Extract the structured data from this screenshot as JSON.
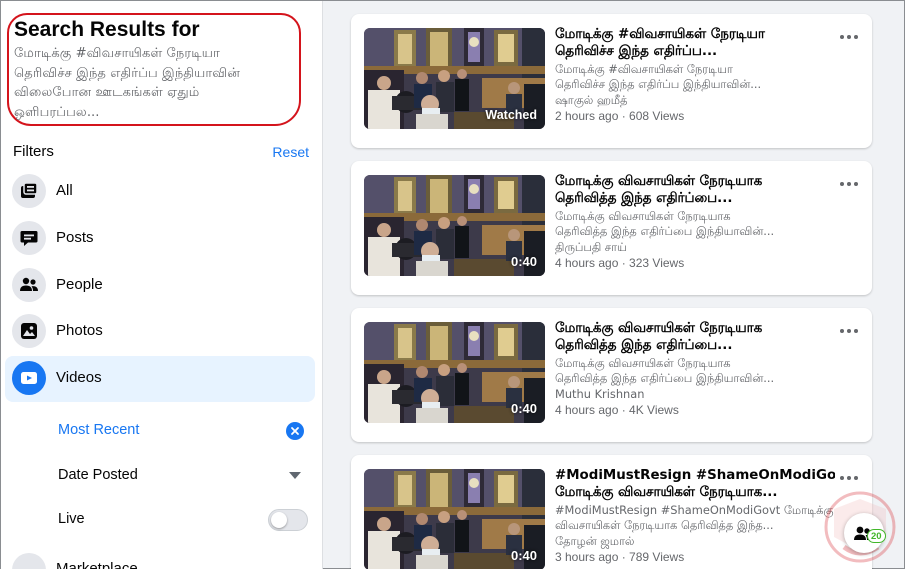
{
  "sidebar": {
    "title": "Search Results for",
    "query_lines": [
      "மோடிக்கு #விவசாயிகள் நேரடியா",
      "தெரிவிச்ச இந்த எதிர்ப்ப இந்தியாவின்",
      "விலைபோன ஊடகங்கள் ஏதும்",
      "ஒளிபரப்பல..."
    ],
    "filters_label": "Filters",
    "reset_label": "Reset",
    "filters": [
      {
        "label": "All",
        "icon": "feed-icon"
      },
      {
        "label": "Posts",
        "icon": "chat-bubble-icon"
      },
      {
        "label": "People",
        "icon": "people-icon"
      },
      {
        "label": "Photos",
        "icon": "photo-icon"
      },
      {
        "label": "Videos",
        "icon": "video-icon",
        "active": true
      }
    ],
    "video_sub": {
      "most_recent": "Most Recent",
      "date_posted": "Date Posted",
      "live": "Live",
      "live_on": false
    },
    "next_filter_peek": "Marketplace"
  },
  "results": [
    {
      "title_lines": [
        "மோடிக்கு #விவசாயிகள் நேரடியா",
        "தெரிவிச்ச இந்த எதிர்ப்ப..."
      ],
      "desc_lines": [
        "மோடிக்கு #விவசாயிகள் நேரடியா",
        "தெரிவிச்ச இந்த எதிர்ப்ப இந்தியாவின்..."
      ],
      "author": "ஷாகுல் ஹமீத்",
      "meta": "2 hours ago · 608 Views",
      "badge": "Watched"
    },
    {
      "title_lines": [
        "மோடிக்கு விவசாயிகள் நேரடியாக",
        "தெரிவித்த இந்த எதிர்ப்பை..."
      ],
      "desc_lines": [
        "மோடிக்கு விவசாயிகள் நேரடியாக",
        "தெரிவித்த இந்த எதிர்ப்பை இந்தியாவின்..."
      ],
      "author": "திருப்பதி சாய்",
      "meta": "4 hours ago · 323 Views",
      "badge": "0:40"
    },
    {
      "title_lines": [
        "மோடிக்கு விவசாயிகள் நேரடியாக",
        "தெரிவித்த இந்த எதிர்ப்பை..."
      ],
      "desc_lines": [
        "மோடிக்கு விவசாயிகள் நேரடியாக",
        "தெரிவித்த இந்த எதிர்ப்பை இந்தியாவின்..."
      ],
      "author": "Muthu Krishnan",
      "meta": "4 hours ago · 4K Views",
      "badge": "0:40"
    },
    {
      "title_lines": [
        "#ModiMustResign #ShameOnModiGovt",
        "மோடிக்கு விவசாயிகள் நேரடியாக..."
      ],
      "desc_lines": [
        "#ModiMustResign #ShameOnModiGovt மோடிக்கு",
        "விவசாயிகள் நேரடியாக தெரிவித்த இந்த..."
      ],
      "author": "தோழன் ஜமால்",
      "meta": "3 hours ago · 789 Views",
      "badge": "0:40"
    }
  ],
  "chat": {
    "count": "20"
  },
  "colors": {
    "accent": "#1877f2",
    "highlight": "#d4141c",
    "chat_badge": "#42b72a"
  }
}
